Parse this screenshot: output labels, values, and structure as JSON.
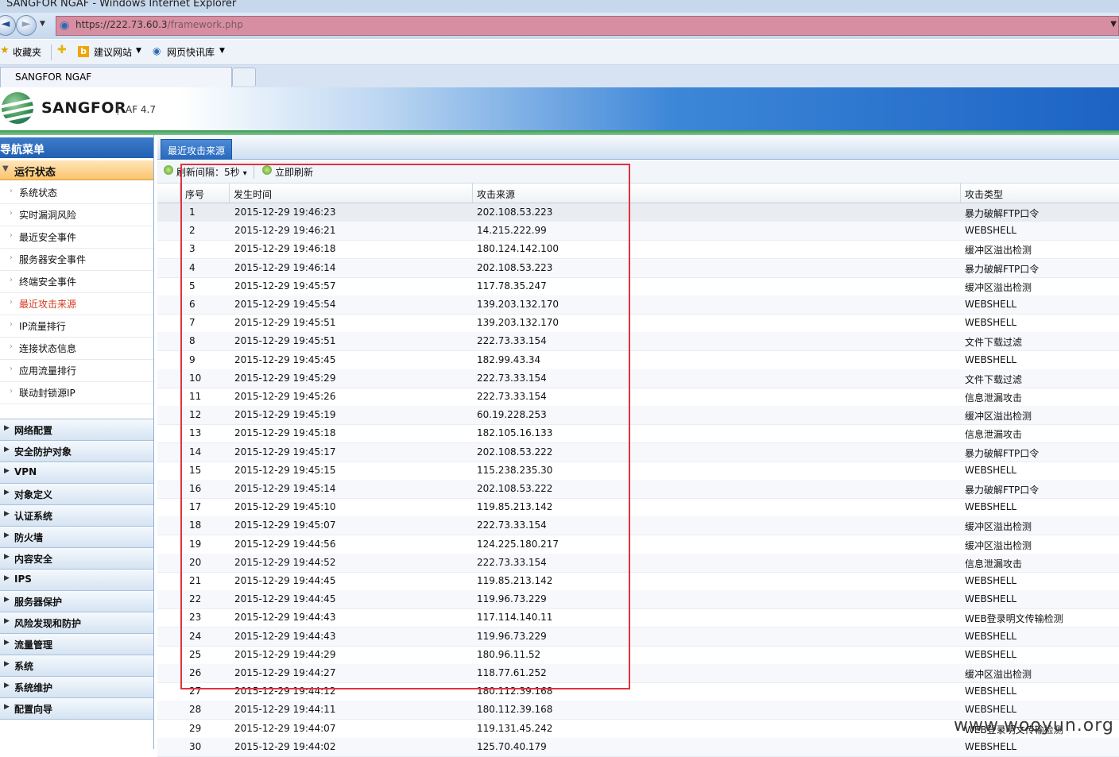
{
  "window": {
    "title": "SANGFOR NGAF - Windows Internet Explorer",
    "url_host": "https://222.73.60.3",
    "url_path": "/framework.php"
  },
  "favorites": {
    "label": "收藏夹",
    "items": [
      "建议网站",
      "网页快讯库"
    ]
  },
  "browser_tab": {
    "label": "SANGFOR NGAF"
  },
  "app": {
    "brand": "SANGFOR",
    "version": "AF 4.7"
  },
  "sidebar": {
    "header": "导航菜单",
    "collapse_glyph": "«",
    "active_group": "运行状态",
    "sub_items": [
      "系统状态",
      "实时漏洞风险",
      "最近安全事件",
      "服务器安全事件",
      "终端安全事件",
      "最近攻击来源",
      "IP流量排行",
      "连接状态信息",
      "应用流量排行",
      "联动封锁源IP"
    ],
    "current_index": 5,
    "groups": [
      "网络配置",
      "安全防护对象",
      "VPN",
      "对象定义",
      "认证系统",
      "防火墙",
      "内容安全",
      "IPS",
      "服务器保护",
      "风险发现和防护",
      "流量管理",
      "系统",
      "系统维护",
      "配置向导"
    ]
  },
  "main": {
    "tab_label": "最近攻击来源",
    "toolbar": {
      "refresh_interval": "刷新间隔：5秒",
      "dropdown_glyph": "▾",
      "refresh_now": "立即刷新"
    },
    "columns": [
      "序号",
      "发生时间",
      "攻击来源",
      "攻击类型"
    ],
    "rows": [
      [
        "1",
        "2015-12-29 19:46:23",
        "202.108.53.223",
        "暴力破解FTP口令"
      ],
      [
        "2",
        "2015-12-29 19:46:21",
        "14.215.222.99",
        "WEBSHELL"
      ],
      [
        "3",
        "2015-12-29 19:46:18",
        "180.124.142.100",
        "缓冲区溢出检测"
      ],
      [
        "4",
        "2015-12-29 19:46:14",
        "202.108.53.223",
        "暴力破解FTP口令"
      ],
      [
        "5",
        "2015-12-29 19:45:57",
        "117.78.35.247",
        "缓冲区溢出检测"
      ],
      [
        "6",
        "2015-12-29 19:45:54",
        "139.203.132.170",
        "WEBSHELL"
      ],
      [
        "7",
        "2015-12-29 19:45:51",
        "139.203.132.170",
        "WEBSHELL"
      ],
      [
        "8",
        "2015-12-29 19:45:51",
        "222.73.33.154",
        "文件下载过滤"
      ],
      [
        "9",
        "2015-12-29 19:45:45",
        "182.99.43.34",
        "WEBSHELL"
      ],
      [
        "10",
        "2015-12-29 19:45:29",
        "222.73.33.154",
        "文件下载过滤"
      ],
      [
        "11",
        "2015-12-29 19:45:26",
        "222.73.33.154",
        "信息泄漏攻击"
      ],
      [
        "12",
        "2015-12-29 19:45:19",
        "60.19.228.253",
        "缓冲区溢出检测"
      ],
      [
        "13",
        "2015-12-29 19:45:18",
        "182.105.16.133",
        "信息泄漏攻击"
      ],
      [
        "14",
        "2015-12-29 19:45:17",
        "202.108.53.222",
        "暴力破解FTP口令"
      ],
      [
        "15",
        "2015-12-29 19:45:15",
        "115.238.235.30",
        "WEBSHELL"
      ],
      [
        "16",
        "2015-12-29 19:45:14",
        "202.108.53.222",
        "暴力破解FTP口令"
      ],
      [
        "17",
        "2015-12-29 19:45:10",
        "119.85.213.142",
        "WEBSHELL"
      ],
      [
        "18",
        "2015-12-29 19:45:07",
        "222.73.33.154",
        "缓冲区溢出检测"
      ],
      [
        "19",
        "2015-12-29 19:44:56",
        "124.225.180.217",
        "缓冲区溢出检测"
      ],
      [
        "20",
        "2015-12-29 19:44:52",
        "222.73.33.154",
        "信息泄漏攻击"
      ],
      [
        "21",
        "2015-12-29 19:44:45",
        "119.85.213.142",
        "WEBSHELL"
      ],
      [
        "22",
        "2015-12-29 19:44:45",
        "119.96.73.229",
        "WEBSHELL"
      ],
      [
        "23",
        "2015-12-29 19:44:43",
        "117.114.140.11",
        "WEB登录明文传输检测"
      ],
      [
        "24",
        "2015-12-29 19:44:43",
        "119.96.73.229",
        "WEBSHELL"
      ],
      [
        "25",
        "2015-12-29 19:44:29",
        "180.96.11.52",
        "WEBSHELL"
      ],
      [
        "26",
        "2015-12-29 19:44:27",
        "118.77.61.252",
        "缓冲区溢出检测"
      ],
      [
        "27",
        "2015-12-29 19:44:12",
        "180.112.39.168",
        "WEBSHELL"
      ],
      [
        "28",
        "2015-12-29 19:44:11",
        "180.112.39.168",
        "WEBSHELL"
      ],
      [
        "29",
        "2015-12-29 19:44:07",
        "119.131.45.242",
        "WEB登录明文传输检测"
      ],
      [
        "30",
        "2015-12-29 19:44:02",
        "125.70.40.179",
        "WEBSHELL"
      ]
    ]
  },
  "watermark": "www.wooyun.org",
  "colors": {
    "highlight_border": "#e3313d",
    "current_menu_text": "#d33b1e",
    "header_blue": "#1c63c4"
  }
}
